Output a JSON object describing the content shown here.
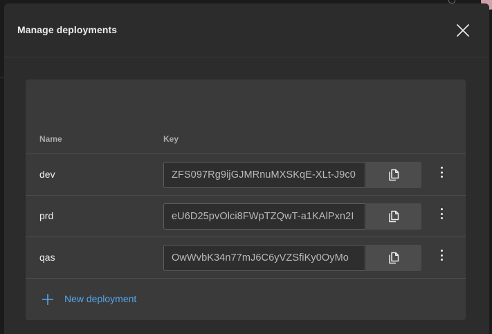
{
  "dialog": {
    "title": "Manage deployments",
    "close_icon": "close-icon"
  },
  "table": {
    "columns": {
      "name": "Name",
      "key": "Key"
    },
    "rows": [
      {
        "name": "dev",
        "key": "ZFS097Rg9ijGJMRnuMXSKqE-XLt-J9c0"
      },
      {
        "name": "prd",
        "key": "eU6D25pvOlci8FWpTZQwT-a1KAlPxn2I"
      },
      {
        "name": "qas",
        "key": "OwWvbK34n77mJ6C6yVZSfiKy0OyMo"
      }
    ],
    "row_icons": {
      "copy": "copy-icon",
      "more": "more-vertical-icon"
    }
  },
  "actions": {
    "new_deployment_label": "New deployment",
    "new_deployment_icon": "plus-icon"
  },
  "colors": {
    "accent": "#54a5ea",
    "dialog_bg": "#2c2c2c",
    "panel_bg": "#3a3a3a"
  }
}
